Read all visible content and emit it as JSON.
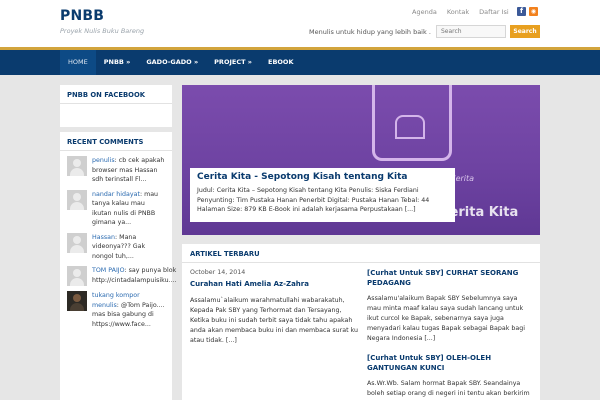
{
  "site": {
    "title": "PNBB",
    "description": "Proyek Nulis Buku Bareng",
    "top_links": [
      "Agenda",
      "Kontak",
      "Daftar Isi"
    ],
    "tagline": "Menulis untuk hidup yang lebih baik .",
    "search": {
      "placeholder": "Search",
      "button": "Search"
    }
  },
  "nav": {
    "items": [
      {
        "label": "HOME"
      },
      {
        "label": "PNBB »"
      },
      {
        "label": "GADO-GADO »"
      },
      {
        "label": "PROJECT »"
      },
      {
        "label": "EBOOK"
      }
    ]
  },
  "sidebar": {
    "facebook_title": "PNBB ON FACEBOOK",
    "comments_title": "RECENT COMMENTS",
    "comments": [
      {
        "author": "penulis",
        "sep": ": ",
        "text": "cb cek apakah browser mas Hassan sdh terinstall Fl..."
      },
      {
        "author": "nandar hidayat",
        "sep": ": ",
        "text": "mau tanya kalau mau ikutan nulis di PNBB gimana ya..."
      },
      {
        "author": "Hassan",
        "sep": ": ",
        "text": "Mana videonya??? Gak nongol tuh,..."
      },
      {
        "author": "TOM PAIJO",
        "sep": ": ",
        "text": "say punya blok http://cintadalampuisiku...."
      },
      {
        "author": "tukang kompor menulis",
        "sep": ": ",
        "text": "@Tom Paijo.... mas bisa gabung di https://www.face..."
      }
    ]
  },
  "featured": {
    "word": "Cerita",
    "banner": "Cerita Kita",
    "title": "Cerita Kita - Sepotong Kisah tentang Kita",
    "excerpt": "Judul: Cerita Kita – Sepotong Kisah tentang Kita Penulis: Siska Ferdiani Penyunting: Tim Pustaka Hanan Penerbit Digital: Pustaka Hanan Tebal: 44 Halaman Size: 879 KB E-Book ini adalah kerjasama Perpustakaan [...]"
  },
  "articles": {
    "heading": "ARTIKEL TERBARU",
    "left": {
      "date": "October 14, 2014",
      "title": "Curahan Hati Amelia Az-Zahra",
      "excerpt": "Assalamu`alaikum warahmatullahi wabarakatuh, Kepada Pak SBY yang Terhormat dan Tersayang, Ketika buku ini sudah terbit saya tidak tahu apakah anda akan membaca buku ini dan membaca surat ku atau tidak. [...]"
    },
    "right": [
      {
        "title": "[Curhat Untuk SBY] CURHAT SEORANG PEDAGANG",
        "excerpt": "Assalamu'alaikum Bapak SBY    Sebelumnya saya mau minta maaf kalau saya sudah lancang untuk ikut curcol ke Bapak, sebenarnya saya juga menyadari kalau tugas Bapak sebagai Bapak bagi Negara Indonesia [...]"
      },
      {
        "title": "[Curhat Untuk SBY] OLEH-OLEH GANTUNGAN KUNCI",
        "excerpt": "As.Wr.Wb. Salam hormat Bapak SBY. Seandainya boleh setiap orang di negeri ini tentu akan berkirim SMS kepada Pak SBY, mungkin saya"
      }
    ]
  }
}
